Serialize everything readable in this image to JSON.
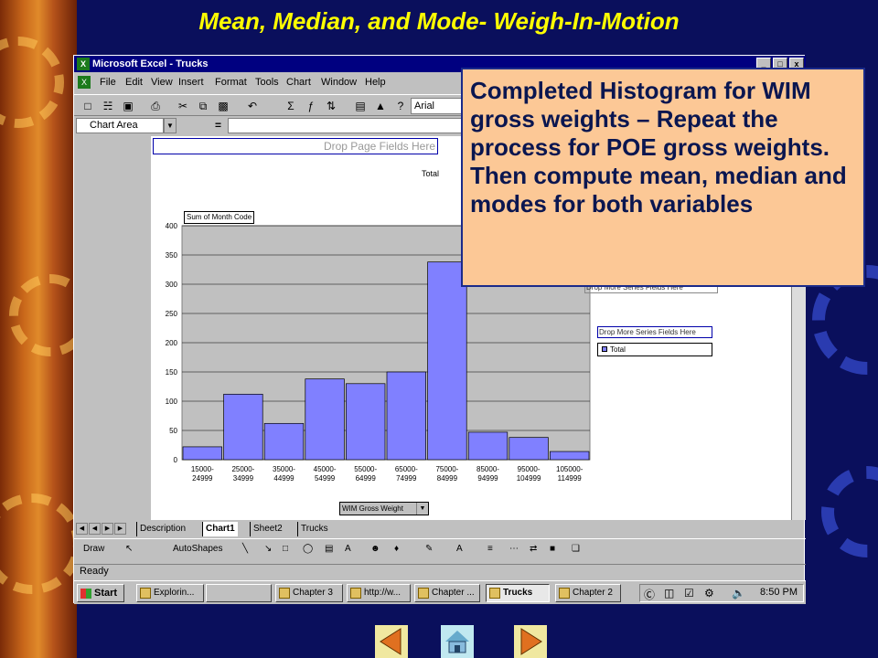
{
  "slide": {
    "title": "Mean, Median, and Mode- Weigh-In-Motion",
    "callout": "Completed Histogram for WIM gross weights – Repeat the process for POE gross weights.  Then compute mean, median and modes for both variables"
  },
  "excel": {
    "window_title": "Microsoft Excel - Trucks",
    "window_buttons": [
      "_",
      "□",
      "x"
    ],
    "menu": [
      "File",
      "Edit",
      "View",
      "Insert",
      "Format",
      "Tools",
      "Chart",
      "Window",
      "Help"
    ],
    "font_name": "Arial",
    "name_box": "Chart Area",
    "formula_eq": "=",
    "drop_page_fields": "Drop Page Fields Here",
    "drop_series_fields": "Drop More Series Fields Here",
    "legend_label": "Total",
    "data_field_label": "Sum of Month Code",
    "category_field_label": "WIM Gross Weight",
    "sheet_tabs": [
      "Description",
      "Chart1",
      "Sheet2",
      "Trucks"
    ],
    "active_sheet": "Chart1",
    "status": "Ready",
    "draw_toolbar": {
      "draw": "Draw",
      "autoshapes": "AutoShapes"
    }
  },
  "taskbar": {
    "start": "Start",
    "items": [
      "Explorin...",
      "",
      "Chapter 3",
      "http://w...",
      "Chapter ...",
      "Trucks",
      "Chapter 2"
    ],
    "active": "Trucks",
    "clock": "8:50 PM"
  },
  "colors": {
    "bar_fill": "#8080ff",
    "plot_bg": "#c0c0c0",
    "callout_bg": "#fcc896",
    "title": "#ffff00"
  },
  "chart_data": {
    "type": "bar",
    "title": "Total",
    "xlabel": "WIM Gross Weight",
    "ylabel": "Sum of Month Code",
    "categories": [
      "15000-24999",
      "25000-34999",
      "35000-44999",
      "45000-54999",
      "55000-64999",
      "65000-74999",
      "75000-84999",
      "85000-94999",
      "95000-104999",
      "105000-114999"
    ],
    "values": [
      22,
      112,
      62,
      138,
      130,
      150,
      338,
      47,
      38,
      14
    ],
    "ylim": [
      0,
      400
    ],
    "yticks": [
      0,
      50,
      100,
      150,
      200,
      250,
      300,
      350,
      400
    ],
    "grid": true,
    "legend": "right"
  }
}
